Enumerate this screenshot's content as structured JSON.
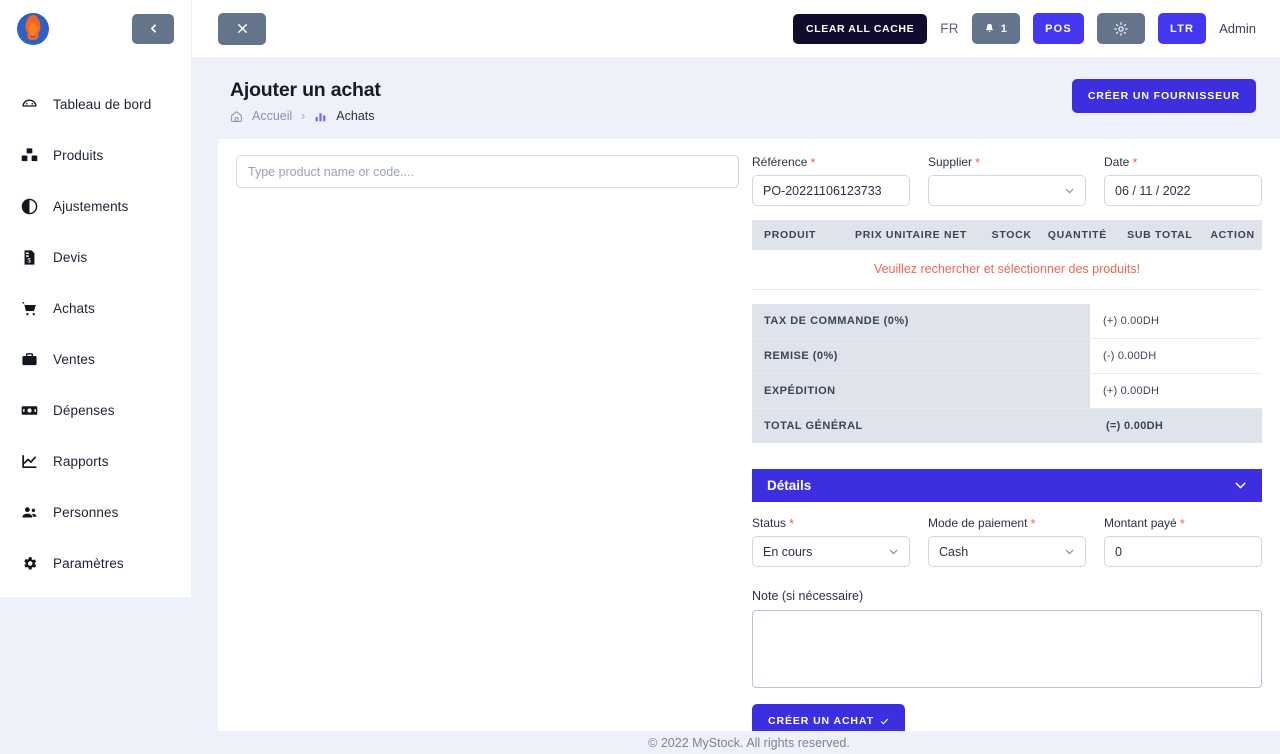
{
  "sidebar": {
    "logo_name": "mystock-flame-logo",
    "collapse_icon": "chevron-left-icon",
    "items": [
      {
        "label": "Tableau de bord",
        "icon": "dashboard-icon"
      },
      {
        "label": "Produits",
        "icon": "boxes-icon"
      },
      {
        "label": "Ajustements",
        "icon": "contrast-circle-icon"
      },
      {
        "label": "Devis",
        "icon": "quote-document-icon"
      },
      {
        "label": "Achats",
        "icon": "shopping-cart-icon"
      },
      {
        "label": "Ventes",
        "icon": "briefcase-icon"
      },
      {
        "label": "Dépenses",
        "icon": "banknote-icon"
      },
      {
        "label": "Rapports",
        "icon": "line-chart-icon"
      },
      {
        "label": "Personnes",
        "icon": "users-icon"
      },
      {
        "label": "Paramètres",
        "icon": "gear-icon"
      }
    ]
  },
  "topbar": {
    "close_icon": "close-x-icon",
    "clear_cache_label": "CLEAR ALL CACHE",
    "language": "FR",
    "notifications_count": "1",
    "notifications_icon": "bell-icon",
    "pos_label": "POS",
    "theme_icon": "sun-icon",
    "direction_label": "LTR",
    "user_label": "Admin"
  },
  "page": {
    "title": "Ajouter un achat",
    "breadcrumb": {
      "home_icon": "home-icon",
      "home_label": "Accueil",
      "separator": "›",
      "current_icon": "bar-chart-icon",
      "current_label": "Achats"
    },
    "create_supplier_label": "CRÉER UN FOURNISSEUR"
  },
  "product_search": {
    "placeholder": "Type product name or code....",
    "value": ""
  },
  "form": {
    "reference": {
      "label": "Référence",
      "required": "*",
      "value": "PO-20221106123733"
    },
    "supplier": {
      "label": "Supplier",
      "required": "*",
      "value": "",
      "chevron_icon": "chevron-down-icon"
    },
    "date": {
      "label": "Date",
      "required": "*",
      "value": "06 / 11 / 2022"
    }
  },
  "product_table": {
    "columns": [
      "PRODUIT",
      "PRIX UNITAIRE NET",
      "STOCK",
      "QUANTITÉ",
      "SUB TOTAL",
      "ACTION"
    ],
    "empty_message": "Veuillez rechercher et sélectionner des produits!"
  },
  "totals": {
    "rows": [
      {
        "label": "TAX DE COMMANDE (0%)",
        "value": "(+) 0.00DH"
      },
      {
        "label": "REMISE (0%)",
        "value": "(-) 0.00DH"
      },
      {
        "label": "EXPÉDITION",
        "value": "(+) 0.00DH"
      }
    ],
    "grand": {
      "label": "TOTAL GÉNÉRAL",
      "value": "(=) 0.00DH"
    }
  },
  "details": {
    "title": "Détails",
    "chevron_icon": "chevron-down-icon",
    "status": {
      "label": "Status",
      "required": "*",
      "value": "En cours",
      "chevron_icon": "chevron-down-icon"
    },
    "payment_mode": {
      "label": "Mode de paiement",
      "required": "*",
      "value": "Cash",
      "chevron_icon": "chevron-down-icon"
    },
    "amount_paid": {
      "label": "Montant payé",
      "required": "*",
      "value": "0"
    },
    "tooltip_icon": "checkbox-icon"
  },
  "note": {
    "label": "Note (si nécessaire)",
    "value": ""
  },
  "submit": {
    "label": "CRÉER UN ACHAT",
    "check_icon": "check-icon"
  },
  "footer": {
    "text": "© 2022 MyStock. All rights reserved."
  },
  "colors": {
    "accent": "#3c2fe0",
    "dark": "#110c2e",
    "gray_btn": "#64748b",
    "danger": "#f4634f",
    "page_bg": "#eef1fa",
    "table_header": "#dfe3ec"
  }
}
